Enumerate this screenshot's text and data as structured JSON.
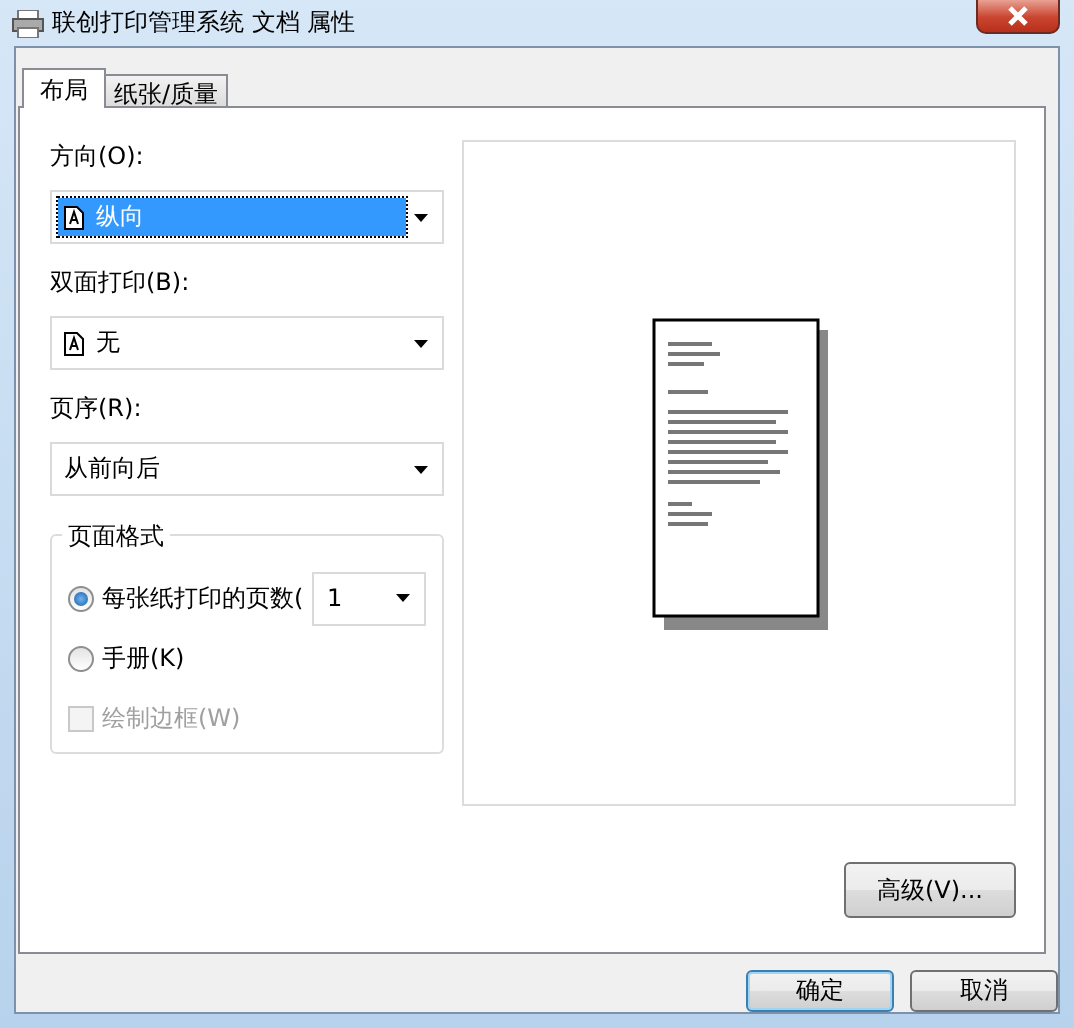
{
  "window": {
    "title": "联创打印管理系统 文档 属性"
  },
  "tabs": [
    {
      "label": "布局",
      "selected": true
    },
    {
      "label": "纸张/质量",
      "selected": false
    }
  ],
  "fields": [
    {
      "label": "方向(O):",
      "value": "纵向",
      "has_icon": true,
      "focused": true
    },
    {
      "label": "双面打印(B):",
      "value": "无",
      "has_icon": true,
      "focused": false
    },
    {
      "label": "页序(R):",
      "value": "从前向后",
      "has_icon": false,
      "focused": false
    }
  ],
  "page_format": {
    "title": "页面格式",
    "options": [
      {
        "kind": "radio",
        "label": "每张纸打印的页数(",
        "selected": true,
        "value": "1"
      },
      {
        "kind": "radio",
        "label": "手册(K)",
        "selected": false
      },
      {
        "kind": "checkbox",
        "label": "绘制边框(W)",
        "checked": false,
        "disabled": true
      }
    ]
  },
  "advanced_button": "高级(V)...",
  "buttons": [
    {
      "label": "确定",
      "default": true
    },
    {
      "label": "取消",
      "default": false
    }
  ]
}
